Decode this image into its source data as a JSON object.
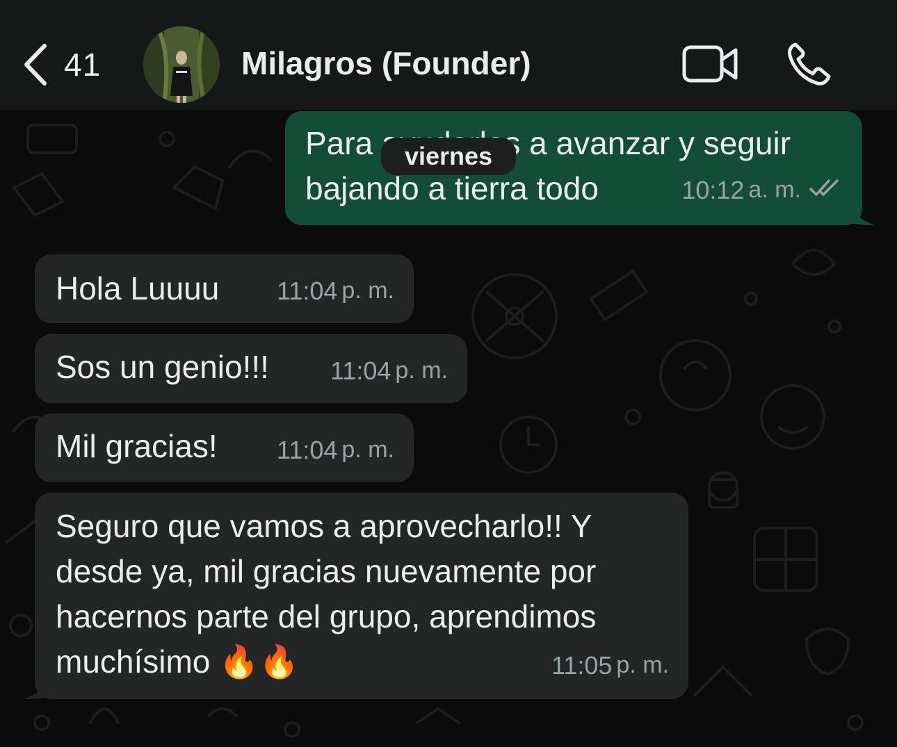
{
  "header": {
    "back_count": "41",
    "contact_name": "Milagros (Founder)"
  },
  "date_separator": "viernes",
  "messages": [
    {
      "direction": "outgoing",
      "text": "Para ayudarlos a avanzar y seguir\nbajando a tierra todo",
      "time": "10:12",
      "ampm": "a. m.",
      "status": "read"
    },
    {
      "direction": "incoming",
      "text": "Hola Luuuu",
      "time": "11:04",
      "ampm": "p. m."
    },
    {
      "direction": "incoming",
      "text": "Sos un genio!!!",
      "time": "11:04",
      "ampm": "p. m."
    },
    {
      "direction": "incoming",
      "text": "Mil gracias!",
      "time": "11:04",
      "ampm": "p. m."
    },
    {
      "direction": "incoming",
      "text": "Seguro que vamos a aprovecharlo!! Y\ndesde ya, mil gracias nuevamente por\nhacernos parte del grupo, aprendimos\nmuchísimo 🔥🔥",
      "time": "11:05",
      "ampm": "p. m."
    }
  ],
  "icons": {
    "back": "chevron-left-icon",
    "video": "video-camera-icon",
    "call": "phone-icon",
    "read_receipt": "double-check-icon"
  },
  "colors": {
    "header_bg": "#161717",
    "chat_bg": "#0b0b0b",
    "incoming_bubble": "#242626",
    "outgoing_bubble": "#144d37",
    "meta_text": "#9aa3a7"
  }
}
